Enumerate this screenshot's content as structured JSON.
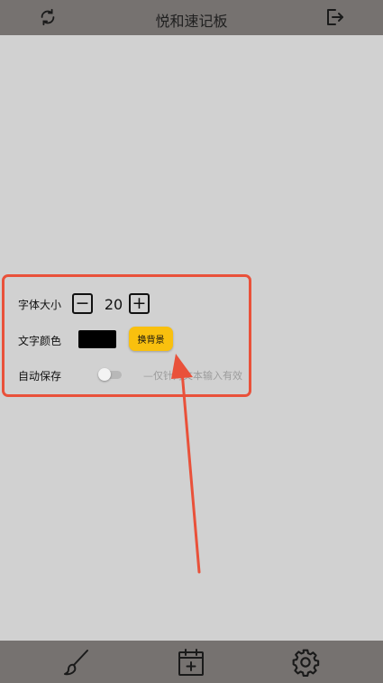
{
  "header": {
    "title": "悦和速记板",
    "left_icon": "refresh-icon",
    "right_icon": "logout-icon"
  },
  "settings": {
    "font_size_label": "字体大小",
    "font_size_decrement": "−",
    "font_size_value": "20",
    "font_size_increment": "+",
    "text_color_label": "文字颜色",
    "text_color": "#000000",
    "change_bg_label": "换背景",
    "autosave_label": "自动保存",
    "autosave_on": false,
    "autosave_hint": "—仅针对文本输入有效"
  },
  "footer": {
    "icons": [
      "brush-icon",
      "calendar-add-icon",
      "gear-icon"
    ]
  },
  "colors": {
    "bar": "#767270",
    "background": "#d1d1d1",
    "highlight": "#e9513a",
    "button": "#f9c00e"
  }
}
